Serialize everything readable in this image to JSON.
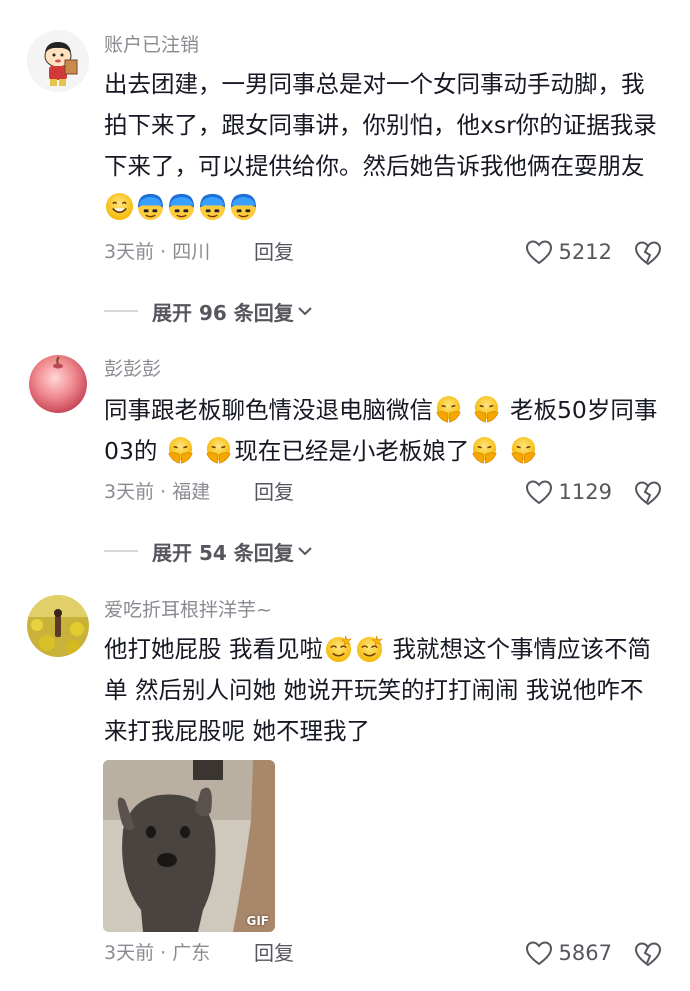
{
  "comments": [
    {
      "username": "账户已注销",
      "text_parts": [
        "出去团建，一男同事总是对一个女同事动手动脚，我拍下来了，跟女同事讲，你别怕，他xsr你的证据我录下来了，可以提供给你。然后她告诉我他俩在耍朋友"
      ],
      "meta": "3天前 · 四川",
      "reply_label": "回复",
      "likes": "5212",
      "expand_label": "展开 96 条回复"
    },
    {
      "username": "彭彭彭",
      "text_a": "同事跟老板聊色情没退电脑微信",
      "text_b": "老板50岁同事03的",
      "text_c": "现在已经是小老板娘了",
      "meta": "3天前 · 福建",
      "reply_label": "回复",
      "likes": "1129",
      "expand_label": "展开 54 条回复"
    },
    {
      "username": "爱吃折耳根拌洋芋~",
      "text_a": "他打她屁股 我看见啦",
      "text_b": "我就想这个事情应该不简单 然后别人问她 她说开玩笑的打打闹闹 我说他咋不来打我屁股呢 她不理我了",
      "gif_badge": "GIF",
      "meta": "3天前 · 广东",
      "reply_label": "回复",
      "likes": "5867"
    }
  ],
  "colors": {
    "text": "#161823",
    "secondary": "#8a8b91",
    "action": "#56575e"
  }
}
